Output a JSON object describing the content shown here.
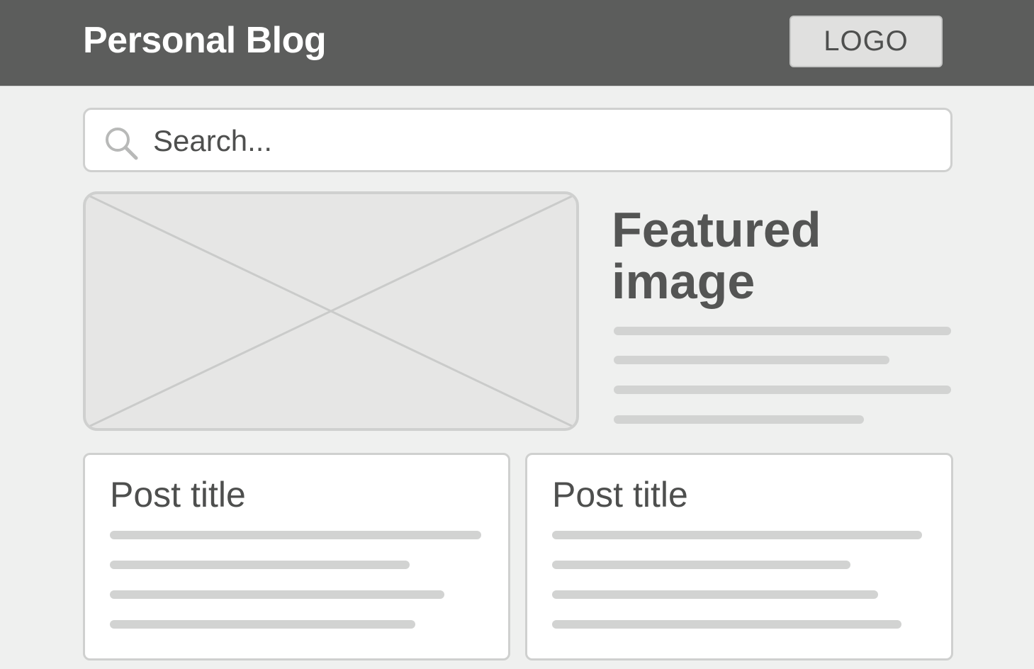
{
  "header": {
    "site_title": "Personal Blog",
    "logo_label": "LOGO"
  },
  "search": {
    "placeholder": "Search...",
    "icon": "search-icon"
  },
  "featured": {
    "image_icon": "image-placeholder-icon",
    "heading": "Featured image"
  },
  "posts": [
    {
      "title": "Post title"
    },
    {
      "title": "Post title"
    }
  ],
  "colors": {
    "header_bg": "#5c5d5c",
    "page_bg": "#eff0ef",
    "placeholder_line": "#d2d3d2",
    "border": "#cfd0cf",
    "text_dark": "#4e4f4e"
  }
}
